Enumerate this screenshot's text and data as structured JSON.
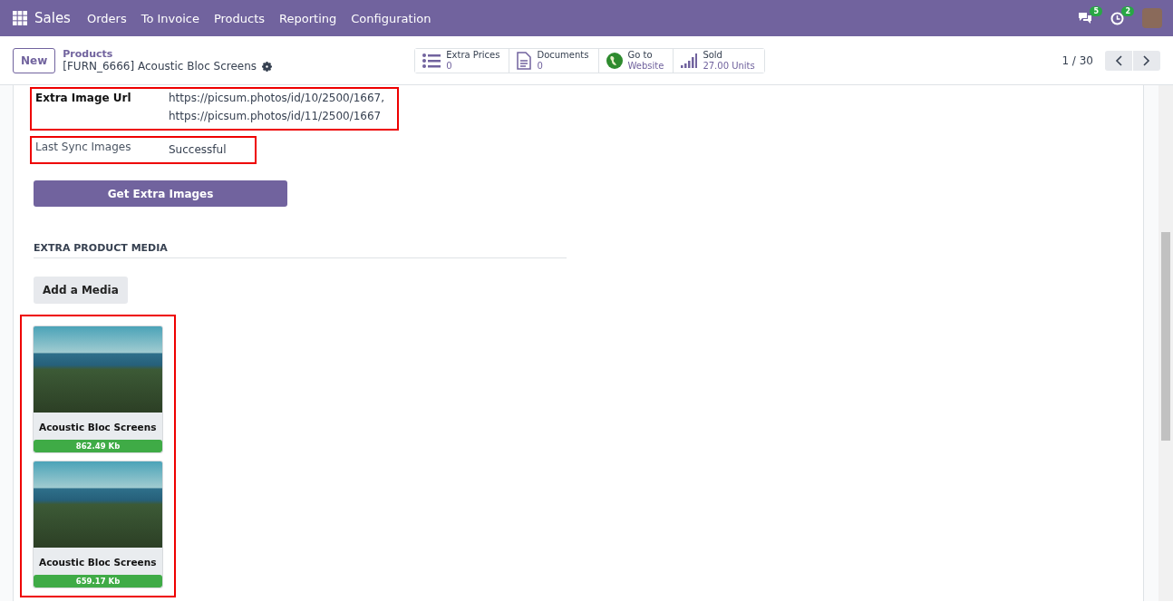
{
  "navbar": {
    "app": "Sales",
    "menu": [
      "Orders",
      "To Invoice",
      "Products",
      "Reporting",
      "Configuration"
    ],
    "messages_count": "5",
    "activities_count": "2"
  },
  "control_panel": {
    "new_button": "New",
    "breadcrumb": "Products",
    "record_title": "[FURN_6666] Acoustic Bloc Screens",
    "stat_buttons": [
      {
        "kind": "list",
        "label": "Extra Prices",
        "value": "0"
      },
      {
        "kind": "document",
        "label": "Documents",
        "value": "0"
      },
      {
        "kind": "globe",
        "label": "Go to",
        "value": "Website"
      },
      {
        "kind": "bars",
        "label": "Sold",
        "value": "27.00 Units"
      }
    ],
    "pager": "1 / 30"
  },
  "form": {
    "fields": [
      {
        "label": "Extra Image Url",
        "bold": true,
        "value": "https://picsum.photos/id/10/2500/1667,\nhttps://picsum.photos/id/11/2500/1667"
      },
      {
        "label": "Last Sync Images",
        "bold": false,
        "value": "Successful"
      }
    ],
    "action_button": "Get Extra Images",
    "section_title": "EXTRA PRODUCT MEDIA",
    "add_button": "Add a Media",
    "media": [
      {
        "name": "Acoustic Bloc Screens",
        "size": "862.49 Kb"
      },
      {
        "name": "Acoustic Bloc Screens",
        "size": "659.17 Kb"
      }
    ]
  }
}
